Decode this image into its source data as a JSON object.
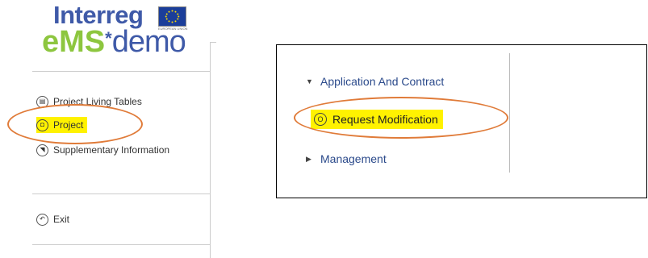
{
  "logo": {
    "line1": "Interreg",
    "ems": "eMS",
    "star": "*",
    "demo": "demo",
    "flag_caption": "EUROPEAN UNION",
    "colors": {
      "blue": "#3f5aa8",
      "green": "#8dc63f"
    }
  },
  "sidebar": {
    "items": [
      {
        "label": "Project Living Tables",
        "icon": "table-icon",
        "glyph": "▤"
      },
      {
        "label": "Project",
        "icon": "project-icon",
        "glyph": "◘",
        "active": true
      },
      {
        "label": "Supplementary Information",
        "icon": "info-icon",
        "glyph": "◥"
      }
    ],
    "exit": {
      "label": "Exit",
      "icon": "exit-icon",
      "glyph": "↶"
    }
  },
  "panel": {
    "items": [
      {
        "label": "Application And Contract",
        "expanded": true,
        "arrow": "▼"
      },
      {
        "label": "Management",
        "expanded": false,
        "arrow": "▶"
      }
    ],
    "sub_item": {
      "label": "Request Modification",
      "icon": "circle-o-icon",
      "glyph": "O"
    }
  },
  "highlight_color": "#fff200",
  "callout_color": "#e07b39"
}
